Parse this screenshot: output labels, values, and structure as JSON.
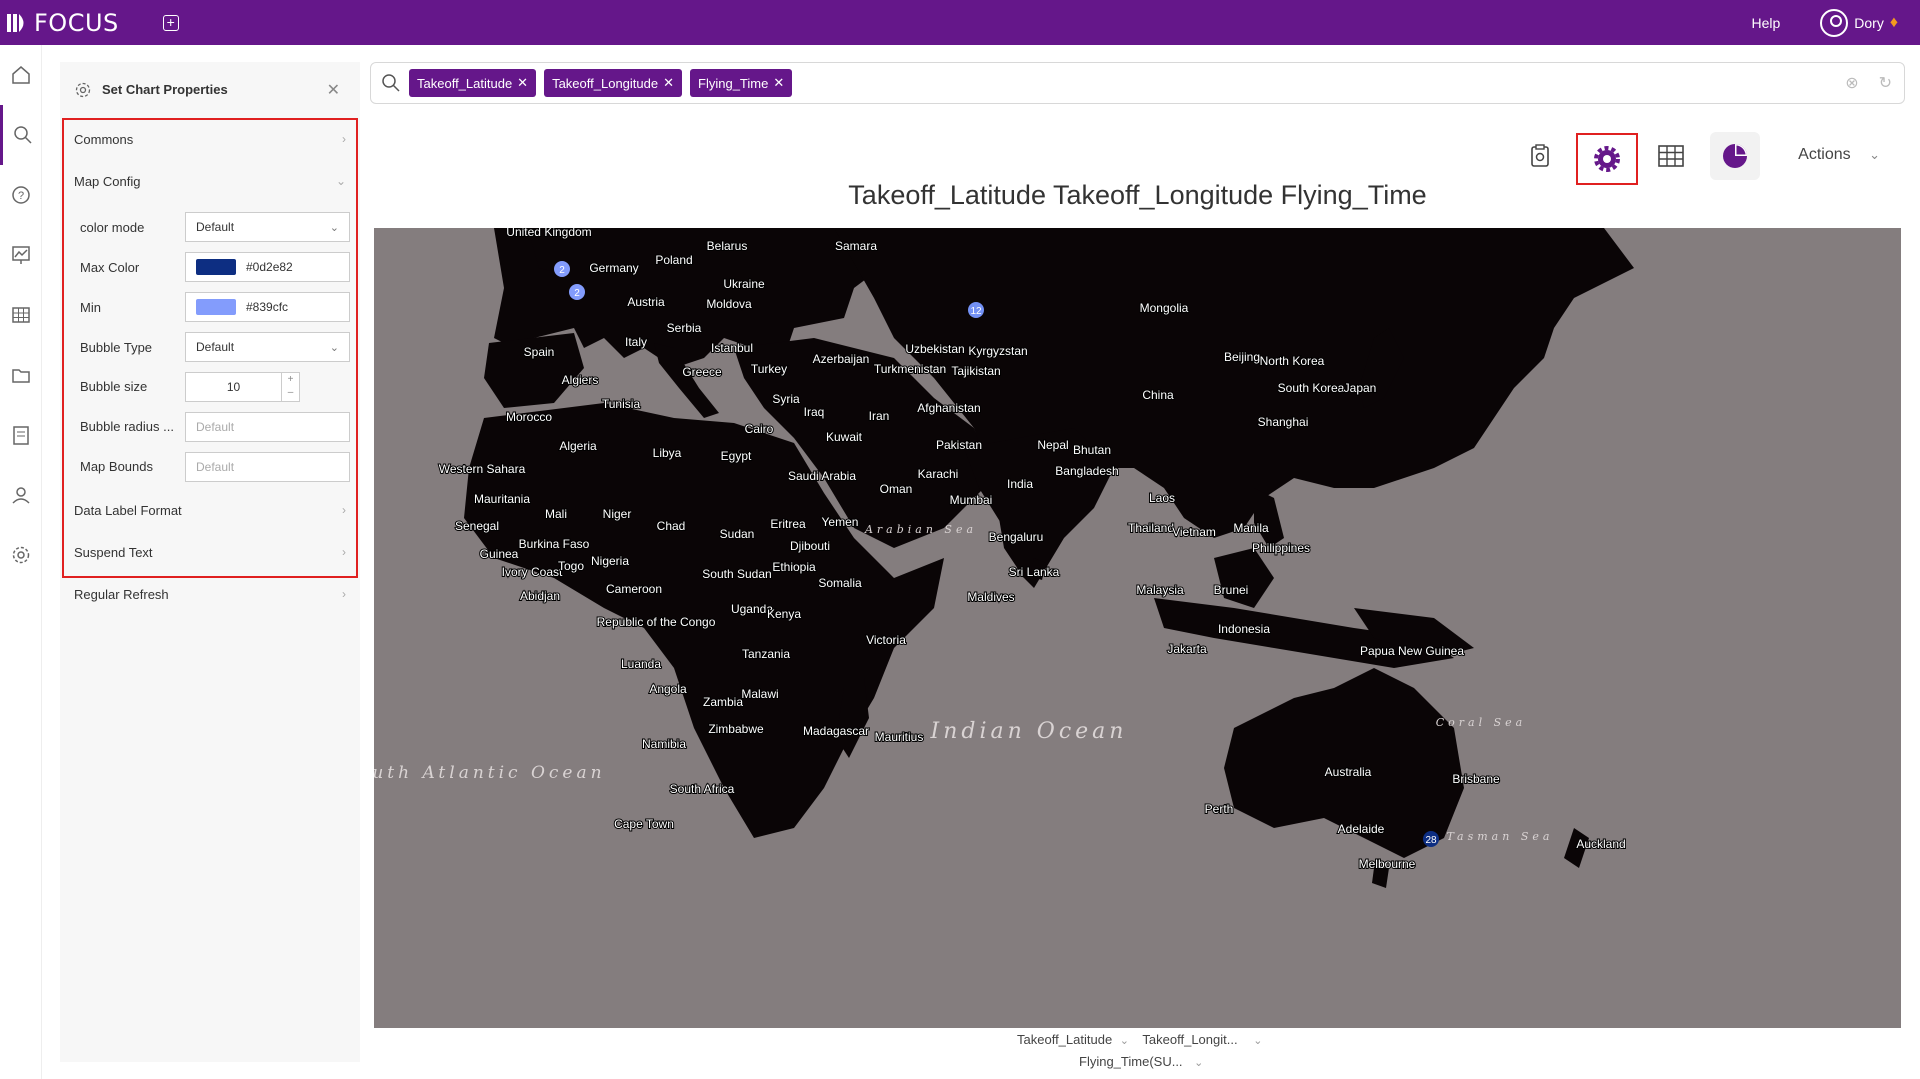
{
  "app": {
    "name": "FOCUS",
    "help": "Help",
    "user": "Dory"
  },
  "props": {
    "title": "Set Chart Properties",
    "sections": {
      "commons": "Commons",
      "map_config": "Map Config",
      "data_label_format": "Data Label Format",
      "suspend_text": "Suspend Text",
      "regular_refresh": "Regular Refresh"
    },
    "fields": {
      "color_mode_label": "color mode",
      "color_mode_value": "Default",
      "max_color_label": "Max Color",
      "max_color_value": "#0d2e82",
      "min_label": "Min",
      "min_value": "#839cfc",
      "bubble_type_label": "Bubble Type",
      "bubble_type_value": "Default",
      "bubble_size_label": "Bubble size",
      "bubble_size_value": "10",
      "bubble_radius_label": "Bubble radius ...",
      "bubble_radius_placeholder": "Default",
      "map_bounds_label": "Map Bounds",
      "map_bounds_placeholder": "Default"
    }
  },
  "search": {
    "tokens": [
      "Takeoff_Latitude",
      "Takeoff_Longitude",
      "Flying_Time"
    ]
  },
  "toolbar": {
    "actions": "Actions"
  },
  "chart": {
    "title": "Takeoff_Latitude Takeoff_Longitude Flying_Time",
    "axis_fields": [
      "Takeoff_Latitude",
      "Takeoff_Longit...",
      "Flying_Time(SU..."
    ]
  },
  "colors": {
    "brand": "#65178a",
    "highlight": "#e02020",
    "map_water": "#847d7e",
    "map_land": "#0a0506"
  },
  "chart_data": {
    "type": "map",
    "points": [
      {
        "label": "2",
        "location": "United Kingdom"
      },
      {
        "label": "2",
        "location": "France"
      },
      {
        "label": "12",
        "location": "Kazakhstan"
      },
      {
        "label": "28",
        "location": "Melbourne"
      }
    ]
  },
  "map_labels": {
    "countries": [
      "United Kingdom",
      "Germany",
      "Poland",
      "Belarus",
      "Ukraine",
      "Moldova",
      "Austria",
      "Serbia",
      "Italy",
      "Spain",
      "Istanbul",
      "Greece",
      "Turkey",
      "Algiers",
      "Tunisia",
      "Syria",
      "Iraq",
      "Iran",
      "Kuwait",
      "Morocco",
      "Algeria",
      "Libya",
      "Egypt",
      "Cairo",
      "Saudi Arabia",
      "Oman",
      "Western Sahara",
      "Mauritania",
      "Mali",
      "Niger",
      "Chad",
      "Sudan",
      "Eritrea",
      "Yemen",
      "Djibouti",
      "Senegal",
      "Burkina Faso",
      "Guinea",
      "Ivory Coast",
      "Togo",
      "Nigeria",
      "Abidjan",
      "Cameroon",
      "South Sudan",
      "Ethiopia",
      "Somalia",
      "Uganda",
      "Kenya",
      "Republic of the Congo",
      "Luanda",
      "Tanzania",
      "Angola",
      "Zambia",
      "Malawi",
      "Namibia",
      "Zimbabwe",
      "South Africa",
      "Cape Town",
      "Madagascar",
      "Mauritius",
      "Victoria",
      "Samara",
      "Mongolia",
      "Uzbekistan",
      "Kyrgyzstan",
      "Azerbaijan",
      "Turkmenistan",
      "Tajikistan",
      "Afghanistan",
      "Pakistan",
      "Karachi",
      "Mumbai",
      "India",
      "Nepal",
      "Bhutan",
      "Bangladesh",
      "Bengaluru",
      "Sri Lanka",
      "Maldives",
      "China",
      "Beijing",
      "North Korea",
      "South Korea",
      "Japan",
      "Shanghai",
      "Laos",
      "Thailand",
      "Vietnam",
      "Manila",
      "Philippines",
      "Malaysia",
      "Brunei",
      "Indonesia",
      "Jakarta",
      "Papua New Guinea",
      "Australia",
      "Brisbane",
      "Perth",
      "Adelaide",
      "Melbourne",
      "Auckland"
    ],
    "oceans": [
      "Arabian Sea",
      "Indian Ocean",
      "South Atlantic Ocean",
      "Coral Sea",
      "Tasman Sea"
    ]
  }
}
